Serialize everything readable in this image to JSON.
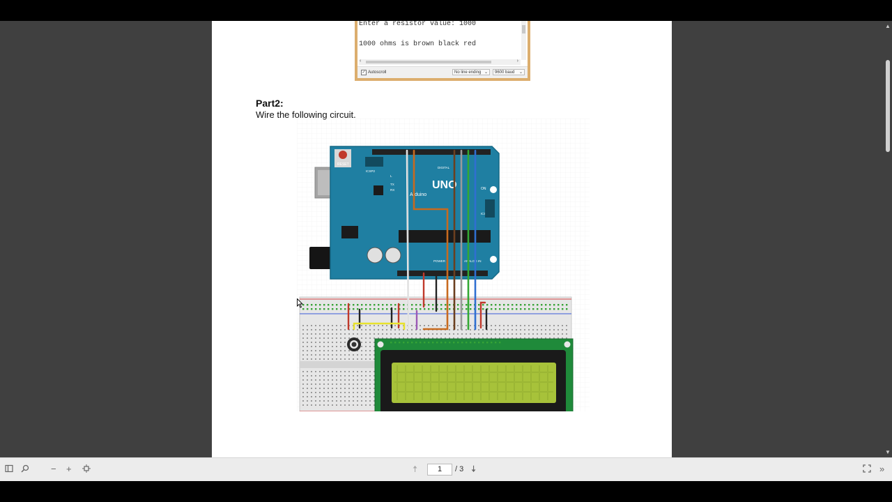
{
  "serial_monitor": {
    "line1": "Enter a resistor value: 1000",
    "line2": "1000 ohms is brown black red",
    "autoscroll_label": "Autoscroll",
    "line_ending": "No line ending",
    "baud": "9600 baud"
  },
  "document": {
    "part_title": "Part2:",
    "part_desc": "Wire the following circuit."
  },
  "circuit": {
    "reset_label": "RESET",
    "icsp2_label": "ICSP2",
    "board_logo": "UNO",
    "board_brand": "Arduino",
    "digital_label": "DIGITAL",
    "power_label": "POWER",
    "analog_label": "ANALOG IN",
    "on_label": "ON",
    "icsp_label": "ICSP",
    "tx_label": "TX",
    "rx_label": "RX",
    "l_label": "L"
  },
  "toolbar": {
    "sidebar_icon": "sidebar-toggle-icon",
    "search_icon": "search-icon",
    "zoom_out_icon": "zoom-out-icon",
    "zoom_in_icon": "zoom-in-icon",
    "fit_icon": "fit-page-icon",
    "prev_icon": "arrow-up-icon",
    "next_icon": "arrow-down-icon",
    "page_number": "1",
    "page_total": "/ 3",
    "fullscreen_icon": "fullscreen-icon",
    "more_icon": "more-tools-icon"
  },
  "colors": {
    "viewer_bg": "#404040",
    "board": "#1f7fa2",
    "lcd_pcb": "#1f8a3a",
    "lcd_screen": "#a7c23a",
    "serial_frame": "#dcae6e"
  }
}
